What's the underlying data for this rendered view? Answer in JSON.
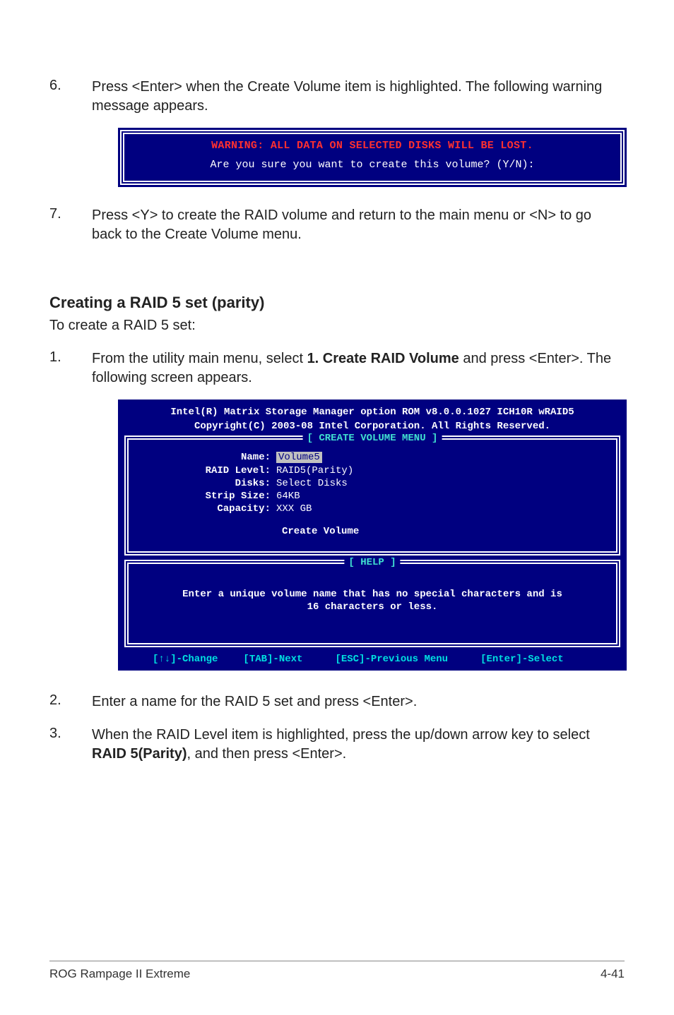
{
  "steps_top": [
    {
      "num": "6.",
      "body_before": "Press <Enter> when the Create Volume item is highlighted. The following warning message appears."
    },
    {
      "num": "7.",
      "body_before": "Press <Y> to create the RAID volume and return to the main menu or <N> to go back to the Create Volume menu."
    }
  ],
  "warn_box": {
    "line1": "WARNING: ALL DATA ON SELECTED DISKS WILL BE LOST.",
    "line2": "Are you sure you want to create this volume? (Y/N):"
  },
  "section": {
    "heading": "Creating a RAID 5 set (parity)",
    "sub": "To create a RAID 5 set:"
  },
  "step1": {
    "num": "1.",
    "pre": "From the utility main menu, select ",
    "bold": "1. Create RAID Volume",
    "post": " and press <Enter>. The following screen appears."
  },
  "bios": {
    "header1": "Intel(R) Matrix Storage Manager option ROM v8.0.0.1027 ICH10R wRAID5",
    "header2": "Copyright(C) 2003-08 Intel Corporation. All Rights Reserved.",
    "box_title": "[ CREATE VOLUME MENU ]",
    "fields": {
      "name_label": "Name:",
      "name_value": "Volume5",
      "raid_label": "RAID Level:",
      "raid_value": "RAID5(Parity)",
      "disks_label": "Disks:",
      "disks_value": "Select Disks",
      "strip_label": "Strip Size:",
      "strip_value": "64KB",
      "cap_label": "Capacity:",
      "cap_value": "XXX  GB"
    },
    "create_volume": "Create Volume",
    "help_title": "[ HELP ]",
    "help_text1": "Enter a unique volume name that has no special characters and is",
    "help_text2": "16 characters or less.",
    "footbar": {
      "change": "[↑↓]-Change",
      "next": "[TAB]-Next",
      "prev": "[ESC]-Previous Menu",
      "select": "[Enter]-Select"
    }
  },
  "steps_bottom": [
    {
      "num": "2.",
      "body": "Enter a name for the RAID 5 set and press <Enter>."
    }
  ],
  "step3": {
    "num": "3.",
    "pre": "When the RAID Level item is highlighted, press the up/down arrow key to select ",
    "bold": "RAID 5(Parity)",
    "post": ", and then press <Enter>."
  },
  "footer": {
    "left": "ROG Rampage II Extreme",
    "right": "4-41"
  }
}
